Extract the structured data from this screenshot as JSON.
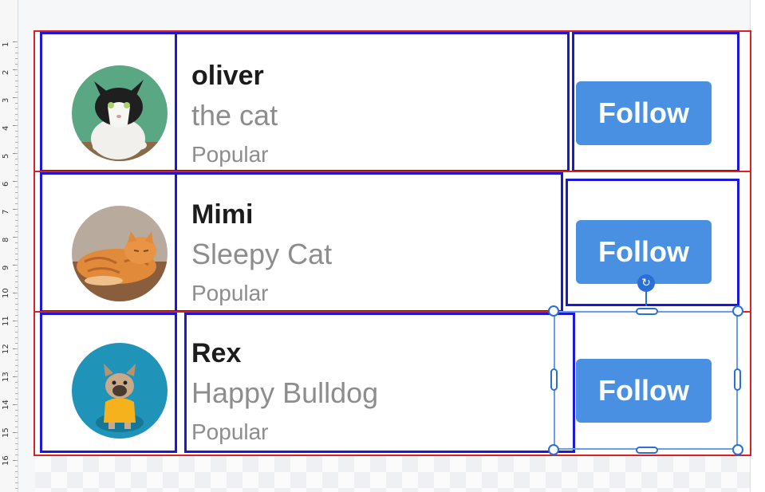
{
  "ruler": {
    "labels": [
      "1",
      "2",
      "3",
      "4",
      "5",
      "6",
      "7",
      "8",
      "9",
      "10",
      "11",
      "12",
      "13",
      "14",
      "15",
      "16"
    ]
  },
  "list": {
    "items": [
      {
        "name": "oliver",
        "subtitle": "the cat",
        "tag": "Popular",
        "button": "Follow",
        "avatar": "tuxedo-cat-photo"
      },
      {
        "name": "Mimi",
        "subtitle": "Sleepy Cat",
        "tag": "Popular",
        "button": "Follow",
        "avatar": "orange-tabby-cat-photo"
      },
      {
        "name": "Rex",
        "subtitle": "Happy Bulldog",
        "tag": "Popular",
        "button": "Follow",
        "avatar": "french-bulldog-photo"
      }
    ]
  },
  "editor": {
    "rotate_icon": "rotate-icon",
    "selection": "selected-cell-follow-rex"
  },
  "colors": {
    "accent": "#4a90e2",
    "frame": "#e02020",
    "outline": "#1a1ad6",
    "selection": "#2a6fd6"
  }
}
